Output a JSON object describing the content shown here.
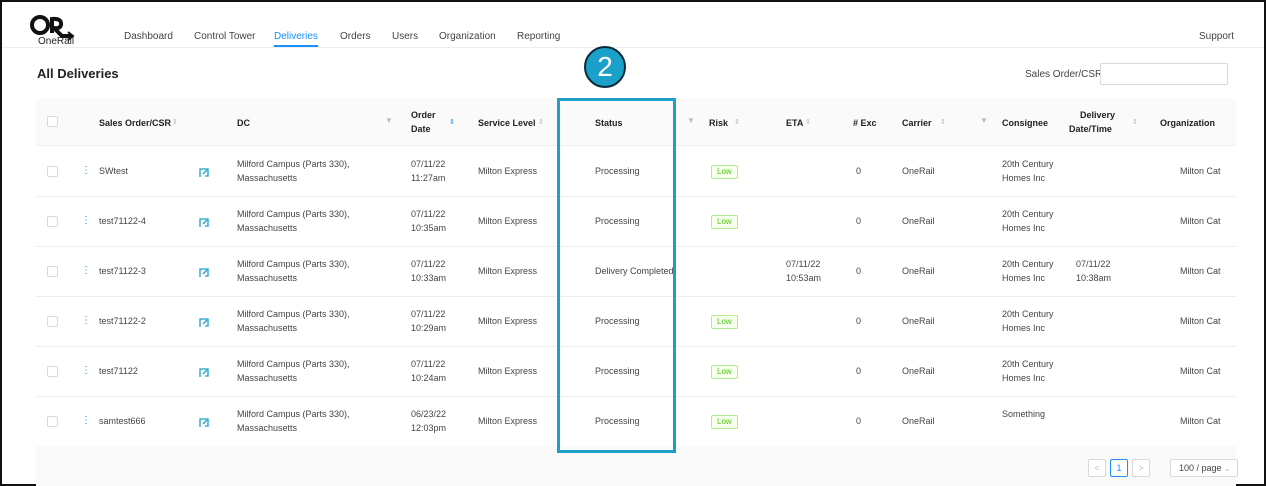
{
  "app": {
    "logo_text": "OneRail"
  },
  "nav": {
    "items": [
      {
        "label": "Dashboard"
      },
      {
        "label": "Control Tower"
      },
      {
        "label": "Deliveries"
      },
      {
        "label": "Orders"
      },
      {
        "label": "Users"
      },
      {
        "label": "Organization"
      },
      {
        "label": "Reporting"
      }
    ],
    "active": "Deliveries",
    "support": "Support"
  },
  "page": {
    "title": "All Deliveries",
    "search_label": "Sales Order/CSR:",
    "search_value": ""
  },
  "annotation": {
    "badge": "2",
    "accent": "#1ba0c9"
  },
  "columns": {
    "sales_order": "Sales Order/CSR",
    "dc": "DC",
    "order_date_1": "Order",
    "order_date_2": "Date",
    "service_level": "Service Level",
    "status": "Status",
    "risk": "Risk",
    "eta": "ETA",
    "exc": "# Exc",
    "carrier": "Carrier",
    "consignee": "Consignee",
    "delivery_1": "Delivery",
    "delivery_2": "Date/Time",
    "organization": "Organization"
  },
  "rows": [
    {
      "order": "SWtest",
      "dc1": "Milford Campus (Parts 330),",
      "dc2": "Massachusetts",
      "date1": "07/11/22",
      "date2": "11:27am",
      "service": "Milton Express",
      "status": "Processing",
      "risk": "Low",
      "eta1": "",
      "eta2": "",
      "exc": "0",
      "carrier": "OneRail",
      "cons1": "20th Century",
      "cons2": "Homes Inc",
      "del1": "",
      "del2": "",
      "org": "Milton Cat"
    },
    {
      "order": "test71122-4",
      "dc1": "Milford Campus (Parts 330),",
      "dc2": "Massachusetts",
      "date1": "07/11/22",
      "date2": "10:35am",
      "service": "Milton Express",
      "status": "Processing",
      "risk": "Low",
      "eta1": "",
      "eta2": "",
      "exc": "0",
      "carrier": "OneRail",
      "cons1": "20th Century",
      "cons2": "Homes Inc",
      "del1": "",
      "del2": "",
      "org": "Milton Cat"
    },
    {
      "order": "test71122-3",
      "dc1": "Milford Campus (Parts 330),",
      "dc2": "Massachusetts",
      "date1": "07/11/22",
      "date2": "10:33am",
      "service": "Milton Express",
      "status": "Delivery Completed",
      "risk": "",
      "eta1": "07/11/22",
      "eta2": "10:53am",
      "exc": "0",
      "carrier": "OneRail",
      "cons1": "20th Century",
      "cons2": "Homes Inc",
      "del1": "07/11/22",
      "del2": "10:38am",
      "org": "Milton Cat"
    },
    {
      "order": "test71122-2",
      "dc1": "Milford Campus (Parts 330),",
      "dc2": "Massachusetts",
      "date1": "07/11/22",
      "date2": "10:29am",
      "service": "Milton Express",
      "status": "Processing",
      "risk": "Low",
      "eta1": "",
      "eta2": "",
      "exc": "0",
      "carrier": "OneRail",
      "cons1": "20th Century",
      "cons2": "Homes Inc",
      "del1": "",
      "del2": "",
      "org": "Milton Cat"
    },
    {
      "order": "test71122",
      "dc1": "Milford Campus (Parts 330),",
      "dc2": "Massachusetts",
      "date1": "07/11/22",
      "date2": "10:24am",
      "service": "Milton Express",
      "status": "Processing",
      "risk": "Low",
      "eta1": "",
      "eta2": "",
      "exc": "0",
      "carrier": "OneRail",
      "cons1": "20th Century",
      "cons2": "Homes Inc",
      "del1": "",
      "del2": "",
      "org": "Milton Cat"
    },
    {
      "order": "samtest666",
      "dc1": "Milford Campus (Parts 330),",
      "dc2": "Massachusetts",
      "date1": "06/23/22",
      "date2": "12:03pm",
      "service": "Milton Express",
      "status": "Processing",
      "risk": "Low",
      "eta1": "",
      "eta2": "",
      "exc": "0",
      "carrier": "OneRail",
      "cons1": "Something",
      "cons2": "",
      "del1": "",
      "del2": "",
      "org": "Milton Cat"
    }
  ],
  "pagination": {
    "prev": "<",
    "current": "1",
    "next": ">",
    "page_size": "100 / page"
  }
}
